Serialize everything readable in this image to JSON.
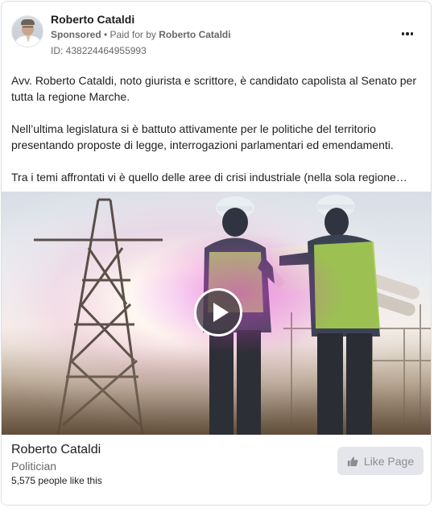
{
  "post": {
    "author": "Roberto Cataldi",
    "sponsored_label": "Sponsored",
    "separator": " • ",
    "paid_prefix": "Paid for by ",
    "paid_by": "Roberto Cataldi",
    "ad_id": "ID: 438224464955993",
    "more_icon": "more-dots-icon",
    "paragraphs": [
      "Avv. Roberto Cataldi, noto giurista e scrittore, è candidato capolista al Senato per tutta la regione Marche.",
      "Nell’ultima legislatura si è battuto attivamente per le politiche del territorio presentando proposte di legge, interrogazioni parlamentari ed emendamenti.",
      "Tra i temi affrontati vi è quello delle aree di crisi industriale (nella sola regione…"
    ]
  },
  "media": {
    "type": "video",
    "play_icon": "play-icon"
  },
  "footer": {
    "page_name": "Roberto Cataldi",
    "category": "Politician",
    "likes": "5,575 people like this",
    "like_button_label": "Like Page",
    "like_icon": "thumbs-up-icon"
  },
  "colors": {
    "text_primary": "#1c1e21",
    "text_secondary": "#65676b",
    "button_bg": "#e4e6eb",
    "button_text_disabled": "#8a8d91",
    "border": "#dadde1"
  }
}
